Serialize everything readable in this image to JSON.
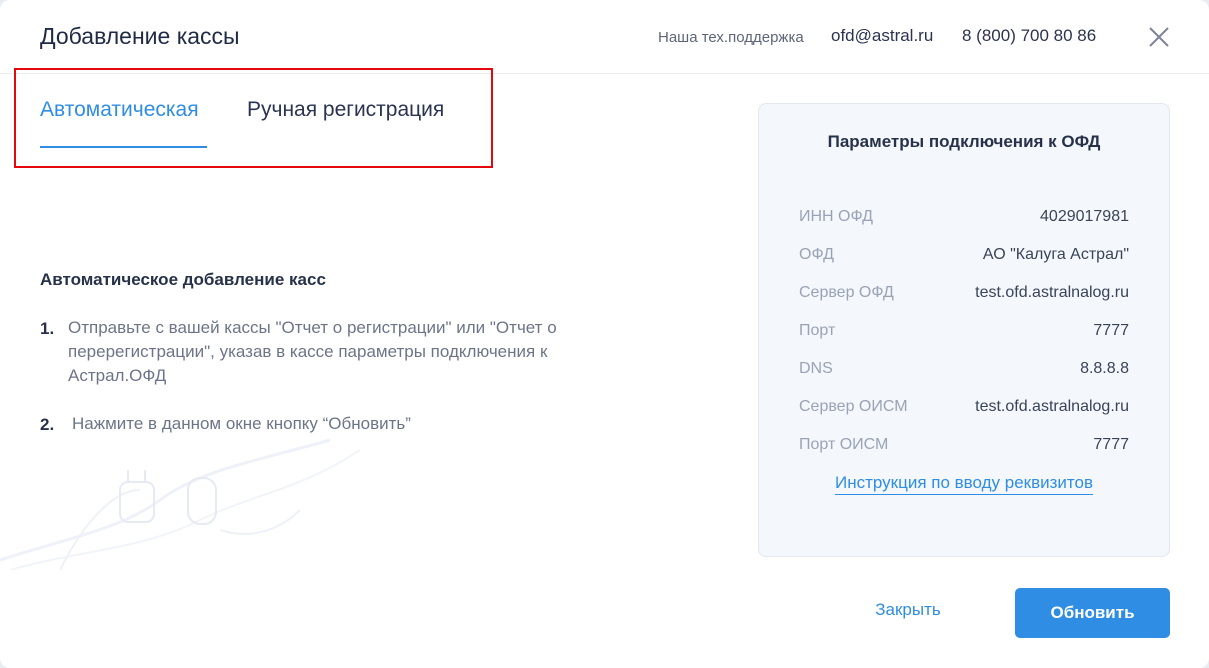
{
  "dialog": {
    "title": "Добавление кассы",
    "support_label": "Наша тех.поддержка",
    "support_email": "ofd@astral.ru",
    "support_phone": "8 (800) 700 80 86"
  },
  "tabs": [
    {
      "label": "Автоматическая",
      "active": true
    },
    {
      "label": "Ручная регистрация",
      "active": false
    }
  ],
  "instructions": {
    "heading": "Автоматическое добавление касс",
    "steps": [
      {
        "number": "1.",
        "lines": [
          "Отправьте с вашей кассы \"Отчет о регистрации\" или \"Отчет о",
          "перерегистрации\", указав в кассе параметры подключения к",
          "Астрал.ОФД"
        ]
      },
      {
        "number": "2.",
        "lines": [
          "Нажмите в данном окне кнопку “Обновить”"
        ]
      }
    ]
  },
  "params": {
    "title": "Параметры подключения к ОФД",
    "rows": [
      {
        "label": "ИНН ОФД",
        "value": "4029017981"
      },
      {
        "label": "ОФД",
        "value": "АО \"Калуга Астрал\""
      },
      {
        "label": "Сервер ОФД",
        "value": "test.ofd.astralnalog.ru"
      },
      {
        "label": "Порт",
        "value": "7777"
      },
      {
        "label": "DNS",
        "value": "8.8.8.8"
      },
      {
        "label": "Сервер ОИСМ",
        "value": "test.ofd.astralnalog.ru"
      },
      {
        "label": "Порт ОИСМ",
        "value": "7777"
      }
    ],
    "link": "Инструкция по вводу реквизитов"
  },
  "footer": {
    "close_label": "Закрыть",
    "refresh_label": "Обновить"
  },
  "colors": {
    "accent": "#2f8de4",
    "highlight_box": "#e4080e",
    "panel_bg": "#f4f7fc"
  }
}
